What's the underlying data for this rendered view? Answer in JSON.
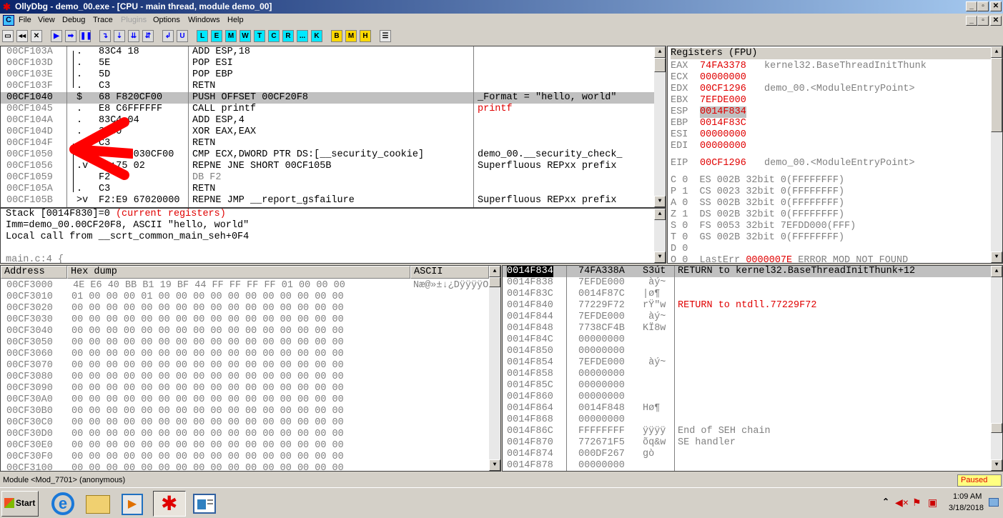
{
  "window": {
    "title": "OllyDbg - demo_00.exe - [CPU - main thread, module demo_00]"
  },
  "menu": [
    "File",
    "View",
    "Debug",
    "Trace",
    "Plugins",
    "Options",
    "Windows",
    "Help"
  ],
  "toolbar_letters": [
    "L",
    "E",
    "M",
    "W",
    "T",
    "C",
    "R",
    "...",
    "K",
    "B",
    "M",
    "H"
  ],
  "disasm": [
    {
      "addr": "00CF103A",
      "dot": ".",
      "hex": "83C4 18",
      "asm": "ADD ESP,18",
      "cmt": ""
    },
    {
      "addr": "00CF103D",
      "dot": ".",
      "hex": "5E",
      "asm": "POP ESI",
      "cmt": ""
    },
    {
      "addr": "00CF103E",
      "dot": ".",
      "hex": "5D",
      "asm": "POP EBP",
      "cmt": ""
    },
    {
      "addr": "00CF103F",
      "dot": ".",
      "hex": "C3",
      "asm": "RETN",
      "cmt": ""
    },
    {
      "addr": "00CF1040",
      "dot": "$",
      "hex": "68 F820CF00",
      "asm": "PUSH OFFSET 00CF20F8",
      "cmt": "_Format = \"hello, world\""
    },
    {
      "addr": "00CF1045",
      "dot": ".",
      "hex": "E8 C6FFFFFF",
      "asm": "CALL printf",
      "cmt": "printf"
    },
    {
      "addr": "00CF104A",
      "dot": ".",
      "hex": "83C4 04",
      "asm": "ADD ESP,4",
      "cmt": ""
    },
    {
      "addr": "00CF104D",
      "dot": ".",
      "hex": "33C0",
      "asm": "XOR EAX,EAX",
      "cmt": ""
    },
    {
      "addr": "00CF104F",
      "dot": ".",
      "hex": "C3",
      "asm": "RETN",
      "cmt": ""
    },
    {
      "addr": "00CF1050",
      "dot": ".",
      "hex": "3B0D 0030CF00",
      "asm": "CMP ECX,DWORD PTR DS:[__security_cookie]",
      "cmt": "demo_00.__security_check_"
    },
    {
      "addr": "00CF1056",
      "dot": ".v",
      "hex": "F2:75 02",
      "asm": "REPNE JNE SHORT 00CF105B",
      "cmt": "Superfluous REPxx prefix"
    },
    {
      "addr": "00CF1059",
      "dot": "",
      "hex": "F2",
      "asm": "DB F2",
      "cmt": ""
    },
    {
      "addr": "00CF105A",
      "dot": ".",
      "hex": "C3",
      "asm": "RETN",
      "cmt": ""
    },
    {
      "addr": "00CF105B",
      "dot": ">v",
      "hex": "F2:E9 67020000",
      "asm": "REPNE JMP __report_gsfailure",
      "cmt": "Superfluous REPxx prefix"
    }
  ],
  "info": [
    {
      "a": "Stack [0014F830]=0 ",
      "b": "(current registers)"
    },
    {
      "a": "Imm=demo_00.00CF20F8, ASCII \"hello, world\"",
      "b": ""
    },
    {
      "a": "Local call from __scrt_common_main_seh+0F4",
      "b": ""
    },
    {
      "a": "",
      "b": ""
    },
    {
      "a": "main.c:4 {",
      "b": ""
    }
  ],
  "registers": {
    "header": "Registers (FPU)",
    "regs": [
      {
        "n": "EAX",
        "v": "74FA3378",
        "d": "kernel32.BaseThreadInitThunk"
      },
      {
        "n": "ECX",
        "v": "00000000",
        "d": ""
      },
      {
        "n": "EDX",
        "v": "00CF1296",
        "d": "demo_00.<ModuleEntryPoint>"
      },
      {
        "n": "EBX",
        "v": "7EFDE000",
        "d": ""
      },
      {
        "n": "ESP",
        "v": "0014F834",
        "d": ""
      },
      {
        "n": "EBP",
        "v": "0014F83C",
        "d": ""
      },
      {
        "n": "ESI",
        "v": "00000000",
        "d": ""
      },
      {
        "n": "EDI",
        "v": "00000000",
        "d": ""
      }
    ],
    "eip": {
      "n": "EIP",
      "v": "00CF1296",
      "d": "demo_00.<ModuleEntryPoint>"
    },
    "flags": [
      "C 0  ES 002B 32bit 0(FFFFFFFF)",
      "P 1  CS 0023 32bit 0(FFFFFFFF)",
      "A 0  SS 002B 32bit 0(FFFFFFFF)",
      "Z 1  DS 002B 32bit 0(FFFFFFFF)",
      "S 0  FS 0053 32bit 7EFDD000(FFF)",
      "T 0  GS 002B 32bit 0(FFFFFFFF)",
      "D 0"
    ],
    "lasterr": {
      "a": "O 0  LastErr ",
      "b": "0000007E",
      "c": " ERROR_MOD_NOT_FOUND"
    }
  },
  "dump": {
    "headers": [
      "Address",
      "Hex dump",
      "ASCII"
    ],
    "first": {
      "addr": "00CF3000",
      "bytes": " 4E E6 40 BB B1 19 BF 44 FF FF FF FF 01 00 00 00",
      "ascii": "Næ@»±↓¿DÿÿÿÿO"
    },
    "rows": [
      {
        "addr": "00CF3010",
        "bytes": "01 00 00 00 01 00 00 00 00 00 00 00 00 00 00 00"
      },
      {
        "addr": "00CF3020",
        "bytes": "00 00 00 00 00 00 00 00 00 00 00 00 00 00 00 00"
      },
      {
        "addr": "00CF3030",
        "bytes": "00 00 00 00 00 00 00 00 00 00 00 00 00 00 00 00"
      },
      {
        "addr": "00CF3040",
        "bytes": "00 00 00 00 00 00 00 00 00 00 00 00 00 00 00 00"
      },
      {
        "addr": "00CF3050",
        "bytes": "00 00 00 00 00 00 00 00 00 00 00 00 00 00 00 00"
      },
      {
        "addr": "00CF3060",
        "bytes": "00 00 00 00 00 00 00 00 00 00 00 00 00 00 00 00"
      },
      {
        "addr": "00CF3070",
        "bytes": "00 00 00 00 00 00 00 00 00 00 00 00 00 00 00 00"
      },
      {
        "addr": "00CF3080",
        "bytes": "00 00 00 00 00 00 00 00 00 00 00 00 00 00 00 00"
      },
      {
        "addr": "00CF3090",
        "bytes": "00 00 00 00 00 00 00 00 00 00 00 00 00 00 00 00"
      },
      {
        "addr": "00CF30A0",
        "bytes": "00 00 00 00 00 00 00 00 00 00 00 00 00 00 00 00"
      },
      {
        "addr": "00CF30B0",
        "bytes": "00 00 00 00 00 00 00 00 00 00 00 00 00 00 00 00"
      },
      {
        "addr": "00CF30C0",
        "bytes": "00 00 00 00 00 00 00 00 00 00 00 00 00 00 00 00"
      },
      {
        "addr": "00CF30D0",
        "bytes": "00 00 00 00 00 00 00 00 00 00 00 00 00 00 00 00"
      },
      {
        "addr": "00CF30E0",
        "bytes": "00 00 00 00 00 00 00 00 00 00 00 00 00 00 00 00"
      },
      {
        "addr": "00CF30F0",
        "bytes": "00 00 00 00 00 00 00 00 00 00 00 00 00 00 00 00"
      },
      {
        "addr": "00CF3100",
        "bytes": "00 00 00 00 00 00 00 00 00 00 00 00 00 00 00 00"
      }
    ]
  },
  "stack": [
    {
      "addr": "0014F834",
      "val": "74FA338A",
      "asc": "Š3út",
      "cmt": "RETURN to kernel32.BaseThreadInitThunk+12"
    },
    {
      "addr": "0014F838",
      "val": "7EFDE000",
      "asc": " àý~",
      "cmt": ""
    },
    {
      "addr": "0014F83C",
      "val": "0014F87C",
      "asc": "|ø¶",
      "cmt": ""
    },
    {
      "addr": "0014F840",
      "val": "77229F72",
      "asc": "rŸ\"w",
      "cmt": "RETURN to ntdll.77229F72"
    },
    {
      "addr": "0014F844",
      "val": "7EFDE000",
      "asc": " àý~",
      "cmt": ""
    },
    {
      "addr": "0014F848",
      "val": "7738CF4B",
      "asc": "KÏ8w",
      "cmt": ""
    },
    {
      "addr": "0014F84C",
      "val": "00000000",
      "asc": "",
      "cmt": ""
    },
    {
      "addr": "0014F850",
      "val": "00000000",
      "asc": "",
      "cmt": ""
    },
    {
      "addr": "0014F854",
      "val": "7EFDE000",
      "asc": " àý~",
      "cmt": ""
    },
    {
      "addr": "0014F858",
      "val": "00000000",
      "asc": "",
      "cmt": ""
    },
    {
      "addr": "0014F85C",
      "val": "00000000",
      "asc": "",
      "cmt": ""
    },
    {
      "addr": "0014F860",
      "val": "00000000",
      "asc": "",
      "cmt": ""
    },
    {
      "addr": "0014F864",
      "val": "0014F848",
      "asc": "Hø¶",
      "cmt": ""
    },
    {
      "addr": "0014F868",
      "val": "00000000",
      "asc": "",
      "cmt": ""
    },
    {
      "addr": "0014F86C",
      "val": "FFFFFFFF",
      "asc": "ÿÿÿÿ",
      "cmt": "End of SEH chain"
    },
    {
      "addr": "0014F870",
      "val": "772671F5",
      "asc": "õq&w",
      "cmt": "SE handler"
    },
    {
      "addr": "0014F874",
      "val": "000DF267",
      "asc": "gò",
      "cmt": ""
    },
    {
      "addr": "0014F878",
      "val": "00000000",
      "asc": "",
      "cmt": ""
    }
  ],
  "status": {
    "left": "Module <Mod_7701> (anonymous)",
    "right": "Paused"
  },
  "taskbar": {
    "start": "Start",
    "time": "1:09 AM",
    "date": "3/18/2018"
  }
}
